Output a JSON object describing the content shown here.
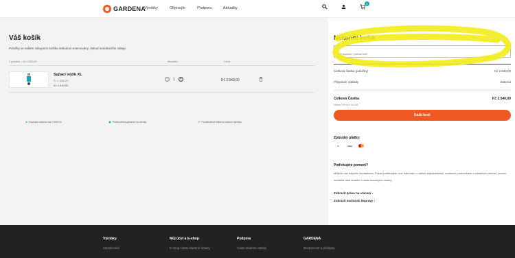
{
  "header": {
    "brand": "GARDENA",
    "nav": [
      "Výrobky",
      "Objevujte",
      "Podpora",
      "Aktuality"
    ],
    "cart_count": "1",
    "icons": [
      "search-icon",
      "user-icon",
      "cart-icon"
    ]
  },
  "cart": {
    "title": "Váš košík",
    "note": "Položky ve vašem nákupním košíku nebudou rezervovány, dokud nedokončíte nákup.",
    "summary": "1 položka – Kč 2.540,00",
    "qty_header": "Množství",
    "total_header": "Cena",
    "items": [
      {
        "name": "Sypací vozík XL",
        "sub": "Č. v. 436-20",
        "unit_price": "Kč 2.540,00",
        "quantity": "1",
        "total": "Kč 2.540,00"
      }
    ],
    "benefits": [
      "Doprava zdarma nad 2.500 Kč",
      "Prodloužená garance na záruky",
      "Prodloužená lhůta na vrácení výrobku"
    ]
  },
  "summary": {
    "title": "Nákupní košík",
    "coupon_placeholder": "Kód kupónu / promo kód",
    "subtotal_label": "Celková částka (položky)",
    "subtotal_value": "Kč 2.540,00",
    "shipping_label": "Přepravní náklady",
    "shipping_value": "Zdarma",
    "total_label": "Celková Částka",
    "total_value": "Kč 2.540,00",
    "vat_note": "včetně DPH Kč 440,83",
    "next_button": "Další krok",
    "accent": "#f05a22"
  },
  "payment": {
    "title": "Způsoby platby:",
    "methods": [
      "P",
      "VISA",
      "mastercard"
    ]
  },
  "help": {
    "title": "Potřebujete pomoct?",
    "text": "Můžete nás kdykoliv kontaktovat. Pokud potřebujete více informací o vašich objednávkách, dodacích podmínkách a zásadách vrácení, prosím navštivte naši stránku s často kladenými dotazy.",
    "link_returns": "Zobrazit práva na vrácení  ›",
    "link_shipping": "Zobrazit možnosti dopravy  ›"
  },
  "footer": {
    "cols": [
      {
        "head": "Výrobky",
        "link": "Zavlažování"
      },
      {
        "head": "Můj účet a E-shop",
        "link": "E-shop Často kladené dotazy"
      },
      {
        "head": "Podpora",
        "link": "Často kladené otázky"
      },
      {
        "head": "GARDENA",
        "link": "Bezpečnost a předpisy"
      }
    ]
  },
  "colors": {
    "accent_orange": "#f05a22",
    "accent_teal": "#1aa6b7",
    "highlighter_yellow": "#f3ec1a",
    "footer_bg": "#222222"
  }
}
